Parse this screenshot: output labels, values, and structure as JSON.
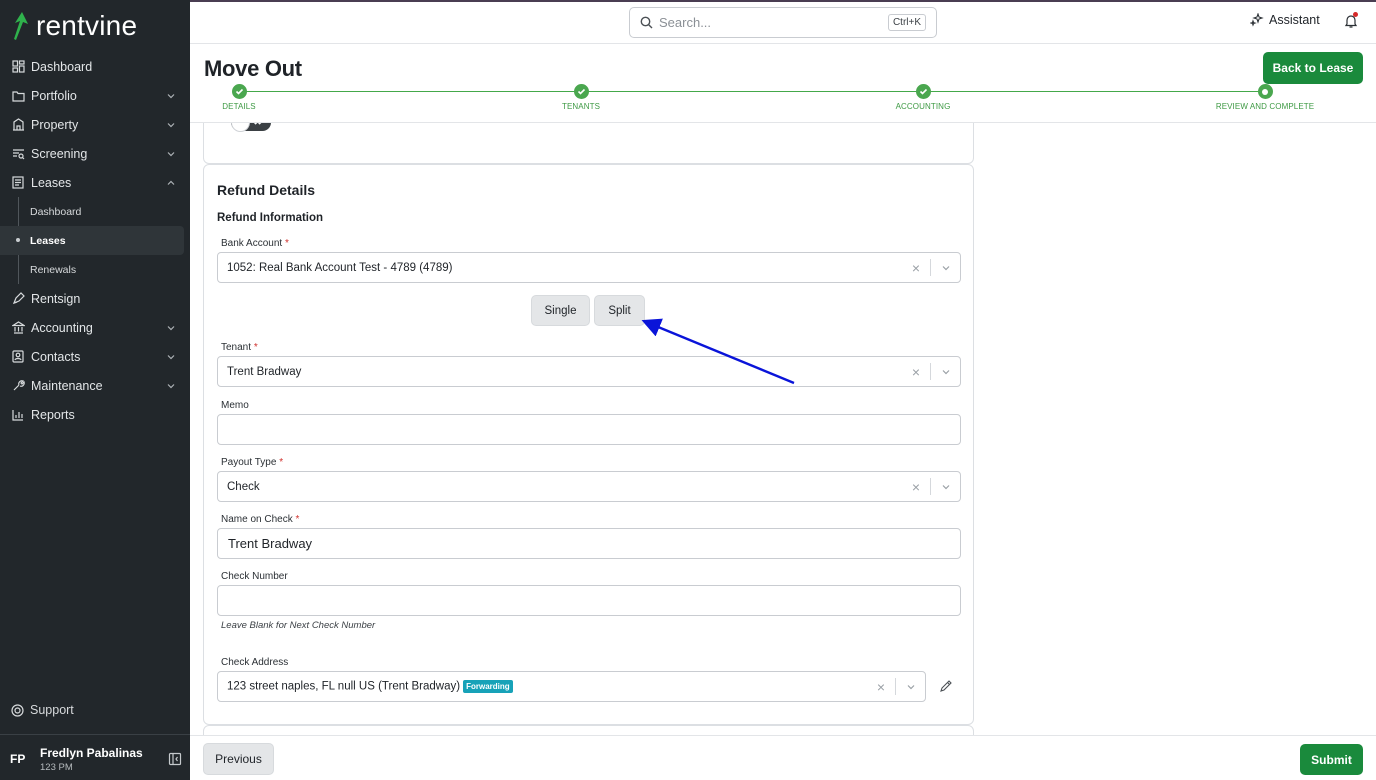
{
  "brand": {
    "name": "rentvine",
    "accent": "#1a8a3c"
  },
  "sidebar": {
    "items": [
      {
        "label": "Dashboard",
        "icon": "dashboard-icon"
      },
      {
        "label": "Portfolio",
        "icon": "folder-icon"
      },
      {
        "label": "Property",
        "icon": "building-icon"
      },
      {
        "label": "Screening",
        "icon": "screening-icon"
      },
      {
        "label": "Leases",
        "icon": "lease-icon"
      },
      {
        "label": "Rentsign",
        "icon": "pen-icon"
      },
      {
        "label": "Accounting",
        "icon": "bank-icon"
      },
      {
        "label": "Contacts",
        "icon": "contacts-icon"
      },
      {
        "label": "Maintenance",
        "icon": "wrench-icon"
      },
      {
        "label": "Reports",
        "icon": "chart-icon"
      }
    ],
    "lease_sub": [
      "Dashboard",
      "Leases",
      "Renewals"
    ],
    "support": "Support",
    "user": {
      "initials": "FP",
      "name": "Fredlyn Pabalinas",
      "sub": "123 PM"
    }
  },
  "topbar": {
    "search_placeholder": "Search...",
    "shortcut": "Ctrl+K",
    "assistant": "Assistant"
  },
  "header": {
    "title": "Move Out",
    "back_button": "Back to Lease",
    "steps": [
      "DETAILS",
      "TENANTS",
      "ACCOUNTING",
      "REVIEW AND COMPLETE"
    ]
  },
  "refund": {
    "card_title": "Refund Details",
    "section_title": "Refund Information",
    "bank_account": {
      "label": "Bank Account",
      "value": "1052: Real Bank Account Test - 4789 (4789)"
    },
    "split_options": [
      "Single",
      "Split"
    ],
    "tenant": {
      "label": "Tenant",
      "value": "Trent Bradway"
    },
    "memo": {
      "label": "Memo",
      "value": ""
    },
    "payout_type": {
      "label": "Payout Type",
      "value": "Check"
    },
    "name_on_check": {
      "label": "Name on Check",
      "value": "Trent Bradway"
    },
    "check_number": {
      "label": "Check Number",
      "value": "",
      "hint": "Leave Blank for Next Check Number"
    },
    "check_address": {
      "label": "Check Address",
      "value": "123 street naples, FL null US (Trent Bradway)",
      "badge": "Forwarding"
    },
    "required_mark": "*"
  },
  "footer": {
    "previous": "Previous",
    "submit": "Submit"
  }
}
